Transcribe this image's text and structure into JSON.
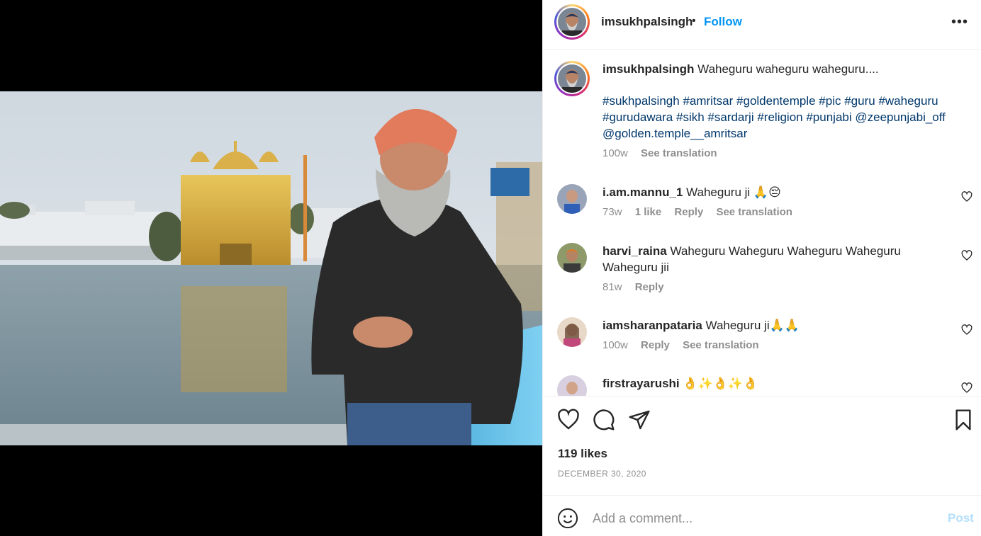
{
  "post": {
    "username": "imsukhpalsingh",
    "separator": "•",
    "follow_label": "Follow",
    "more_label": "•••",
    "caption_text": "Waheguru waheguru waheguru....",
    "hashtags": [
      "#sukhpalsingh",
      "#amritsar",
      "#goldentemple",
      "#pic",
      "#guru",
      "#waheguru",
      "#gurudawara",
      "#sikh",
      "#sardarji",
      "#religion",
      "#punjabi",
      "@zeepunjabi_off",
      "@golden.temple__amritsar"
    ],
    "caption_time": "100w",
    "see_translation": "See translation"
  },
  "comments": [
    {
      "username": "i.am.mannu_1",
      "text": "Waheguru ji 🙏😔",
      "time": "73w",
      "likes": "1 like",
      "reply": "Reply",
      "translate": "See translation"
    },
    {
      "username": "harvi_raina",
      "text": "Waheguru Waheguru Waheguru Waheguru Waheguru jii",
      "time": "81w",
      "reply": "Reply"
    },
    {
      "username": "iamsharanpataria",
      "text": "Waheguru ji🙏🙏",
      "time": "100w",
      "reply": "Reply",
      "translate": "See translation"
    },
    {
      "username": "firstrayarushi",
      "text": "👌✨👌✨👌"
    }
  ],
  "footer": {
    "likes": "119 likes",
    "date": "DECEMBER 30, 2020",
    "comment_placeholder": "Add a comment...",
    "post_label": "Post"
  },
  "colors": {
    "accent": "#0095f6",
    "hashtag": "#00376b",
    "muted": "#8e8e8e",
    "post_disabled": "#b2dffc"
  }
}
